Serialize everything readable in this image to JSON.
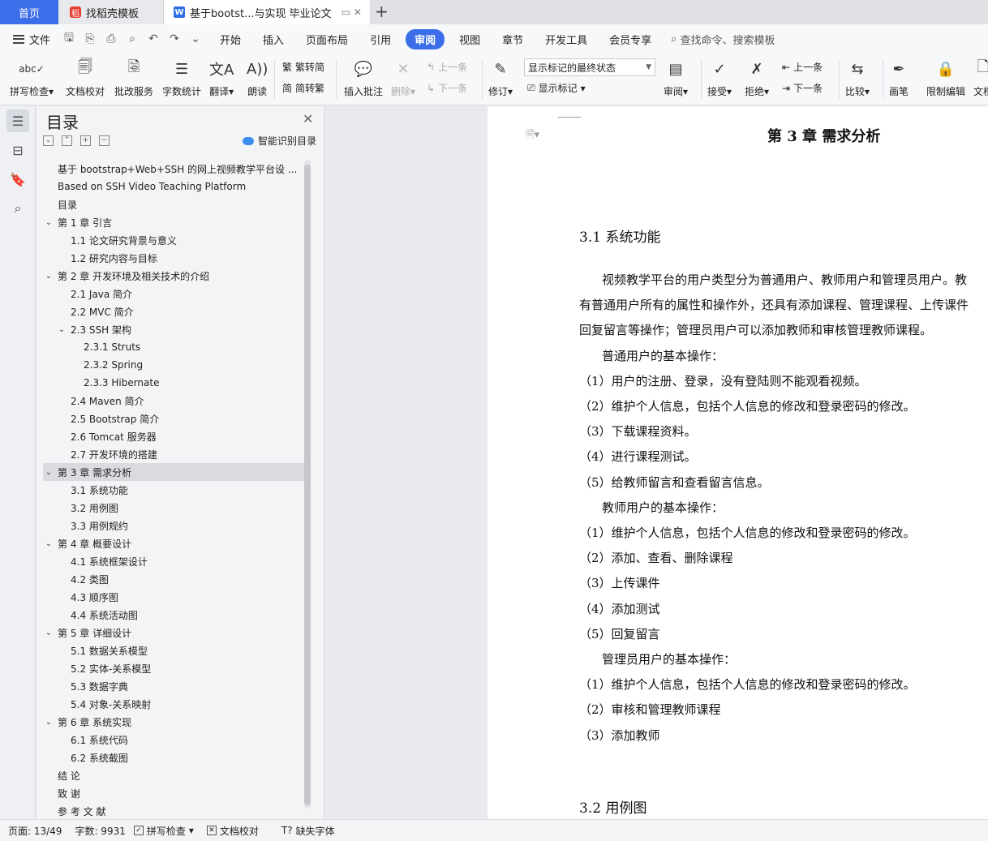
{
  "tabs": {
    "home": "首页",
    "template": "找稻壳模板",
    "document": "基于bootst...与实现 毕业论文",
    "new_tab": "+"
  },
  "menubar": {
    "file": "文件",
    "items": [
      "开始",
      "插入",
      "页面布局",
      "引用",
      "审阅",
      "视图",
      "章节",
      "开发工具",
      "会员专享"
    ],
    "active": "审阅",
    "search_placeholder": "查找命令、搜索模板"
  },
  "ribbon": {
    "spell_check": "拼写检查",
    "doc_proof": "文档校对",
    "review_service": "批改服务",
    "word_count": "字数统计",
    "translate": "翻译",
    "read_aloud": "朗读",
    "trad": "繁转简",
    "simp": "简转繁",
    "insert_comment": "插入批注",
    "delete": "删除",
    "prev": "上一条",
    "next": "下一条",
    "revise": "修订",
    "markup_state": "显示标记的最终状态",
    "show_markup": "显示标记",
    "review": "审阅",
    "accept": "接受",
    "reject": "拒绝",
    "prev2": "上一条",
    "next2": "下一条",
    "compare": "比较",
    "pen": "画笔",
    "restrict": "限制编辑",
    "doc_cut": "文档"
  },
  "toc": {
    "title": "目录",
    "smart_label": "智能识别目录",
    "items": [
      {
        "text": "基于 bootstrap+Web+SSH 的网上视频教学平台设 ...",
        "level": 0,
        "caret": ""
      },
      {
        "text": "Based on SSH Video Teaching Platform",
        "level": 0,
        "caret": ""
      },
      {
        "text": "目录",
        "level": 0,
        "caret": ""
      },
      {
        "text": "第 1 章  引言",
        "level": 0,
        "caret": "v"
      },
      {
        "text": "1.1  论文研究背景与意义",
        "level": 1,
        "caret": ""
      },
      {
        "text": "1.2  研究内容与目标",
        "level": 1,
        "caret": ""
      },
      {
        "text": "第 2 章  开发环境及相关技术的介绍",
        "level": 0,
        "caret": "v"
      },
      {
        "text": "2.1 Java 简介",
        "level": 1,
        "caret": ""
      },
      {
        "text": "2.2 MVC 简介",
        "level": 1,
        "caret": ""
      },
      {
        "text": "2.3 SSH 架构",
        "level": 1,
        "caret": "v"
      },
      {
        "text": "2.3.1 Struts",
        "level": 2,
        "caret": ""
      },
      {
        "text": "2.3.2 Spring",
        "level": 2,
        "caret": ""
      },
      {
        "text": "2.3.3 Hibernate",
        "level": 2,
        "caret": ""
      },
      {
        "text": "2.4 Maven 简介",
        "level": 1,
        "caret": ""
      },
      {
        "text": "2.5 Bootstrap 简介",
        "level": 1,
        "caret": ""
      },
      {
        "text": "2.6 Tomcat 服务器",
        "level": 1,
        "caret": ""
      },
      {
        "text": "2.7  开发环境的搭建",
        "level": 1,
        "caret": ""
      },
      {
        "text": "第 3 章  需求分析",
        "level": 0,
        "caret": "v",
        "selected": true
      },
      {
        "text": "3.1  系统功能",
        "level": 1,
        "caret": ""
      },
      {
        "text": "3.2  用例图",
        "level": 1,
        "caret": ""
      },
      {
        "text": "3.3  用例规约",
        "level": 1,
        "caret": ""
      },
      {
        "text": "第 4 章  概要设计",
        "level": 0,
        "caret": "v"
      },
      {
        "text": "4.1  系统框架设计",
        "level": 1,
        "caret": ""
      },
      {
        "text": "4.2  类图",
        "level": 1,
        "caret": ""
      },
      {
        "text": "4.3  顺序图",
        "level": 1,
        "caret": ""
      },
      {
        "text": "4.4  系统活动图",
        "level": 1,
        "caret": ""
      },
      {
        "text": "第 5 章  详细设计",
        "level": 0,
        "caret": "v"
      },
      {
        "text": "5.1  数据关系模型",
        "level": 1,
        "caret": ""
      },
      {
        "text": "5.2  实体-关系模型",
        "level": 1,
        "caret": ""
      },
      {
        "text": "5.3  数据字典",
        "level": 1,
        "caret": ""
      },
      {
        "text": "5.4  对象-关系映射",
        "level": 1,
        "caret": ""
      },
      {
        "text": "第 6 章  系统实现",
        "level": 0,
        "caret": "v"
      },
      {
        "text": "6.1  系统代码",
        "level": 1,
        "caret": ""
      },
      {
        "text": "6.2  系统截图",
        "level": 1,
        "caret": ""
      },
      {
        "text": "结  论",
        "level": 0,
        "caret": ""
      },
      {
        "text": "致  谢",
        "level": 0,
        "caret": ""
      },
      {
        "text": "参 考 文 献",
        "level": 0,
        "caret": ""
      }
    ]
  },
  "document": {
    "chapter_title": "第 3 章  需求分析",
    "section_1": "3.1  系统功能",
    "section_2": "3.2  用例图",
    "paragraphs": [
      {
        "text": "视频教学平台的用户类型分为普通用户、教师用户和管理员用户。教",
        "indent": true
      },
      {
        "text": "有普通用户所有的属性和操作外，还具有添加课程、管理课程、上传课件",
        "indent": false
      },
      {
        "text": "回复留言等操作；管理员用户可以添加教师和审核管理教师课程。",
        "indent": false
      },
      {
        "text": "普通用户的基本操作：",
        "indent": true
      },
      {
        "text": "（1）用户的注册、登录，没有登陆则不能观看视频。",
        "indent": false
      },
      {
        "text": "（2）维护个人信息，包括个人信息的修改和登录密码的修改。",
        "indent": false
      },
      {
        "text": "（3）下载课程资料。",
        "indent": false
      },
      {
        "text": "（4）进行课程测试。",
        "indent": false
      },
      {
        "text": "（5）给教师留言和查看留言信息。",
        "indent": false
      },
      {
        "text": "教师用户的基本操作：",
        "indent": true
      },
      {
        "text": "（1）维护个人信息，包括个人信息的修改和登录密码的修改。",
        "indent": false
      },
      {
        "text": "（2）添加、查看、删除课程",
        "indent": false
      },
      {
        "text": "（3）上传课件",
        "indent": false
      },
      {
        "text": "（4）添加测试",
        "indent": false
      },
      {
        "text": "（5）回复留言",
        "indent": false
      },
      {
        "text": "管理员用户的基本操作：",
        "indent": true
      },
      {
        "text": "（1）维护个人信息，包括个人信息的修改和登录密码的修改。",
        "indent": false
      },
      {
        "text": "（2）审核和管理教师课程",
        "indent": false
      },
      {
        "text": "（3）添加教师",
        "indent": false
      }
    ]
  },
  "status": {
    "page": "页面: 13/49",
    "words": "字数: 9931",
    "spell": "拼写检查",
    "proof": "文档校对",
    "missing_font": "缺失字体"
  },
  "colors": {
    "accent": "#3b6ee8"
  }
}
